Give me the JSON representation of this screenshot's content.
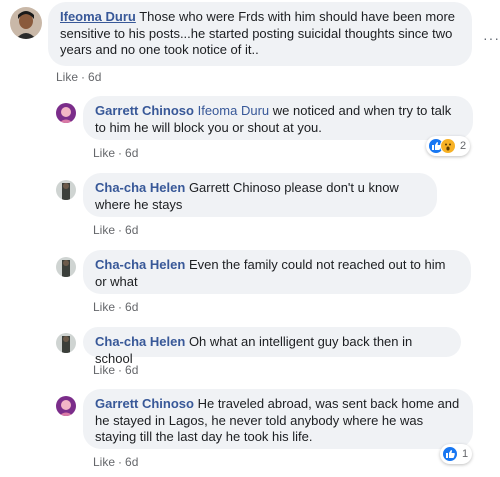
{
  "top_comment": {
    "author": "Ifeoma Duru",
    "text": "Those who were Frds with him should have been more sensitive to his posts...he started posting suicidal thoughts since two years and no one took notice of it..",
    "like_label": "Like",
    "age": "6d"
  },
  "replies": [
    {
      "author": "Garrett Chinoso",
      "mention": "Ifeoma Duru",
      "text": "we noticed and when try to talk to him he will block you or shout at you.",
      "like_label": "Like",
      "age": "6d",
      "reaction_count": "2"
    },
    {
      "author": "Cha-cha Helen",
      "mention": "",
      "text": "Garrett Chinoso please don't u know where he stays",
      "like_label": "Like",
      "age": "6d"
    },
    {
      "author": "Cha-cha Helen",
      "mention": "",
      "text": "Even the family could not reached out to him or what",
      "like_label": "Like",
      "age": "6d"
    },
    {
      "author": "Cha-cha Helen",
      "mention": "",
      "text": "Oh what an intelligent guy back then in school",
      "like_label": "Like",
      "age": "6d"
    },
    {
      "author": "Garrett Chinoso",
      "mention": "",
      "text": "He traveled abroad, was sent back home and he stayed in Lagos, he never told anybody where he was staying till the last day he took his life.",
      "like_label": "Like",
      "age": "6d",
      "reaction_count": "1"
    }
  ],
  "more_label": "···",
  "colors": {
    "bubble_bg": "#f0f2f5",
    "name_blue": "#385898",
    "meta_gray": "#65676b",
    "like_blue": "#1877f2"
  }
}
